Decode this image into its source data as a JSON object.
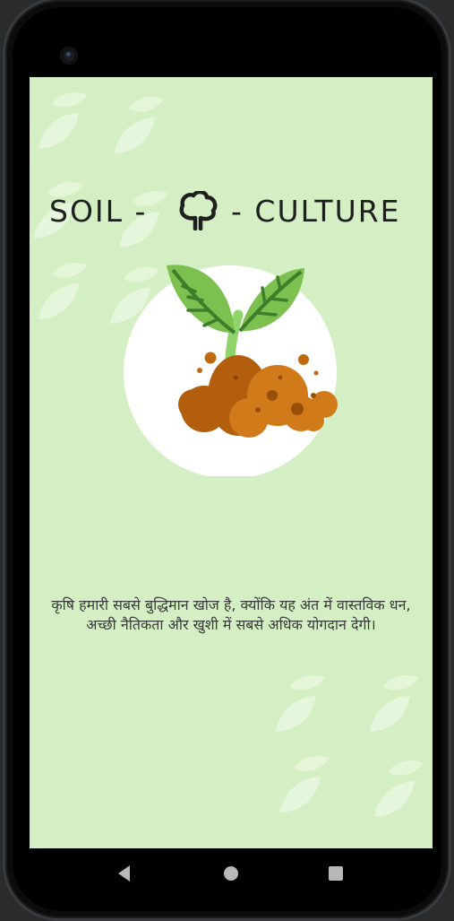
{
  "app": {
    "logo_left": "SOIL -",
    "logo_right": "- CULTURE",
    "quote": "कृषि हमारी सबसे बुद्धिमान खोज है, क्योंकि यह अंत में वास्तविक धन, अच्छी नैतिकता और खुशी में सबसे अधिक योगदान देगी।"
  },
  "icons": {
    "logo": "tree-outline-icon",
    "illustration": "sprout-in-soil-icon",
    "nav_back": "back-triangle-icon",
    "nav_home": "home-circle-icon",
    "nav_recents": "recents-square-icon"
  },
  "colors": {
    "screen_background": "#d4efc4",
    "leaf_green": "#7cc04f",
    "soil_brown": "#c06a10",
    "text_dark": "#1f1f1f"
  }
}
